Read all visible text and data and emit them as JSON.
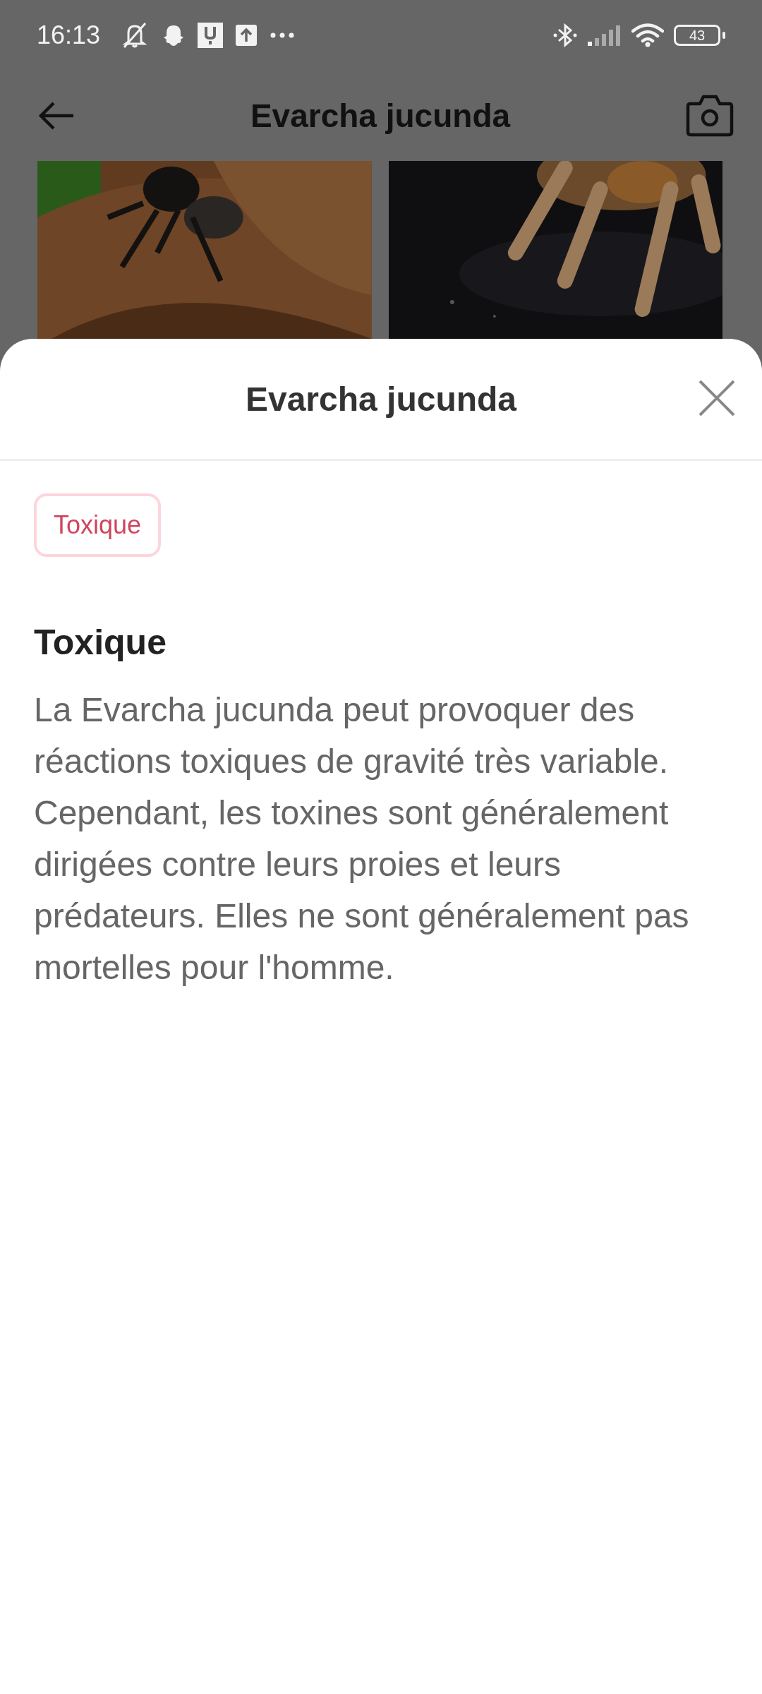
{
  "status_bar": {
    "time": "16:13",
    "battery": "43"
  },
  "app_bar": {
    "title": "Evarcha jucunda"
  },
  "sheet": {
    "title": "Evarcha jucunda",
    "tags": [
      {
        "label": "Toxique"
      }
    ],
    "section": {
      "heading": "Toxique",
      "body": "La Evarcha jucunda peut provoquer des réactions toxiques de gravité très variable. Cependant, les toxines sont généralement dirigées contre leurs proies et leurs prédateurs. Elles ne sont généralement pas mortelles pour l'homme."
    }
  }
}
